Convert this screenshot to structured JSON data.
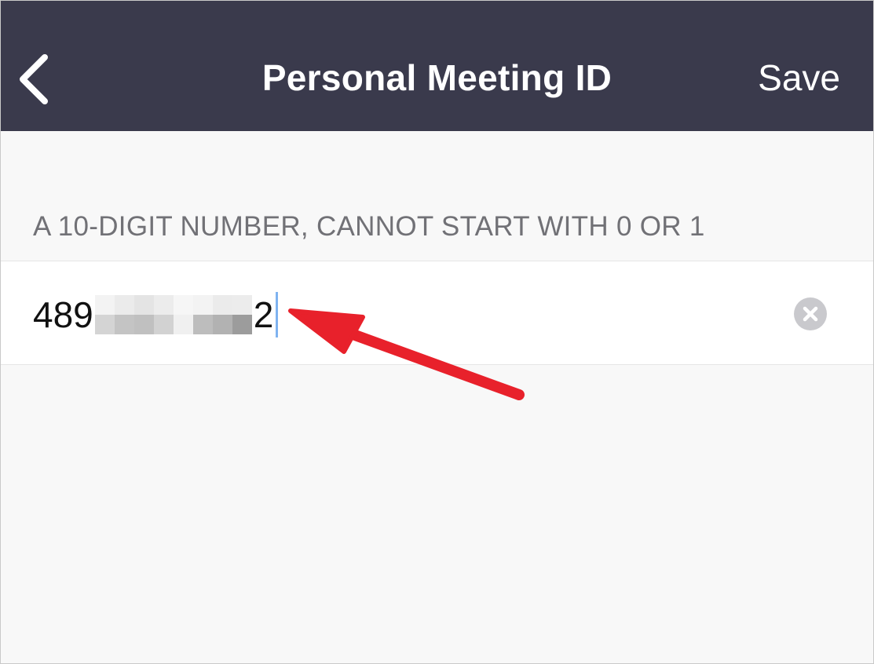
{
  "nav": {
    "title": "Personal Meeting ID",
    "save_label": "Save",
    "back_icon": "chevron-left-icon"
  },
  "section": {
    "header": "A 10-DIGIT NUMBER, CANNOT START WITH 0 OR 1"
  },
  "meeting_id_field": {
    "visible_prefix": "489",
    "visible_suffix": "2",
    "obscured_digits": 6,
    "clear_icon": "clear-circle-icon"
  },
  "annotation": {
    "type": "arrow",
    "points_to": "text-caret",
    "color": "#e8212b"
  },
  "colors": {
    "navbar_bg": "#3a3a4c",
    "page_bg": "#f8f8f8",
    "caret": "#7fb3f0",
    "annotation": "#e8212b"
  }
}
